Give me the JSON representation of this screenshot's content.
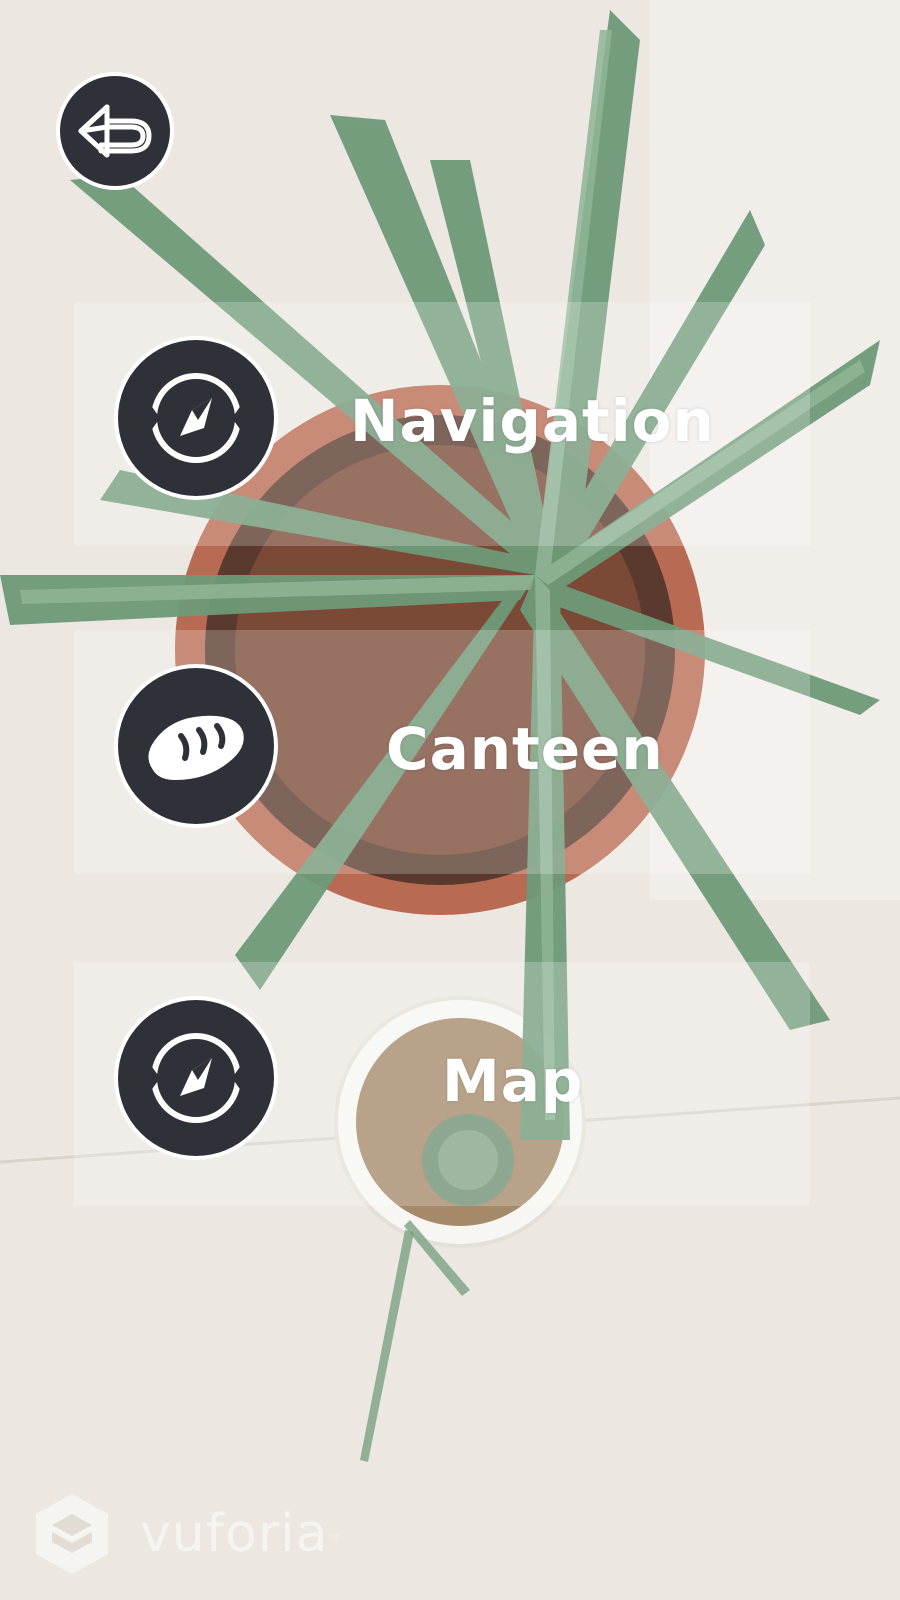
{
  "back_button": {
    "icon": "back-arrow-icon"
  },
  "menu": {
    "items": [
      {
        "label": "Navigation",
        "icon": "compass-icon"
      },
      {
        "label": "Canteen",
        "icon": "bread-icon"
      },
      {
        "label": "Map",
        "icon": "compass-icon"
      }
    ]
  },
  "branding": {
    "text": "vuforia",
    "mark": "™"
  },
  "colors": {
    "icon_background": "#2f3138",
    "icon_foreground": "#ffffff",
    "tile_overlay": "rgba(255,255,255,0.22)",
    "label": "#ffffff"
  }
}
